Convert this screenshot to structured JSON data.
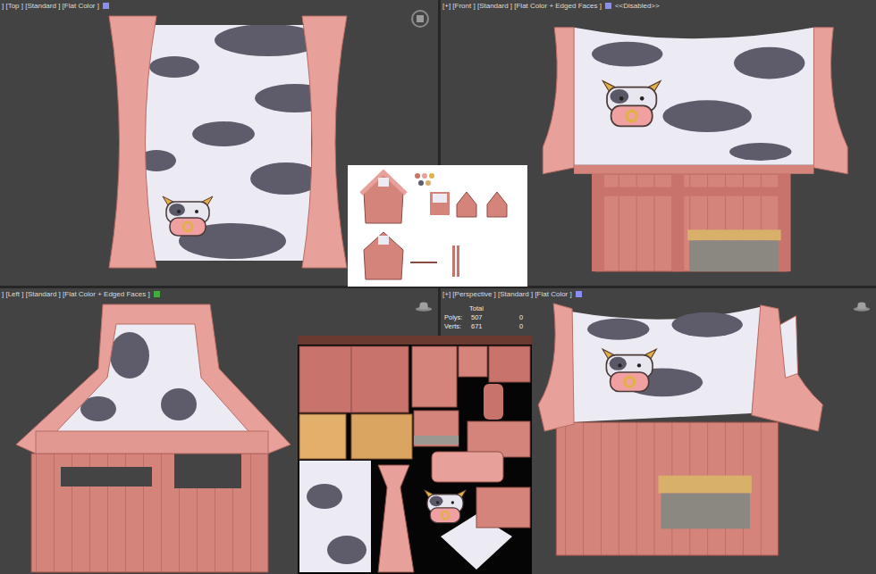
{
  "viewports": [
    {
      "view": "top",
      "label": "] [Top ] [Standard ] [Flat Color ]",
      "note": "",
      "color": "#8a8ef0",
      "corner_icon": "gizmo"
    },
    {
      "view": "front",
      "label": "[+] [Front ] [Standard ] [Flat Color + Edged Faces ]",
      "note": "<<Disabled>>",
      "color": "#8a8ef0",
      "corner_icon": "none"
    },
    {
      "view": "left",
      "label": "] [Left ] [Standard ] [Flat Color + Edged Faces ]",
      "note": "",
      "color": "#3fae3f",
      "corner_icon": "hat"
    },
    {
      "view": "perspective",
      "label": "[+] [Perspective ] [Standard ] [Flat Color ]",
      "note": "",
      "color": "#8a8ef0",
      "corner_icon": "hat"
    }
  ],
  "stats": {
    "title": "Total",
    "rows": [
      {
        "label": "Polys:",
        "total": "507",
        "sel_count": "0"
      },
      {
        "label": "Verts:",
        "total": "671",
        "sel_count": "0"
      }
    ]
  }
}
